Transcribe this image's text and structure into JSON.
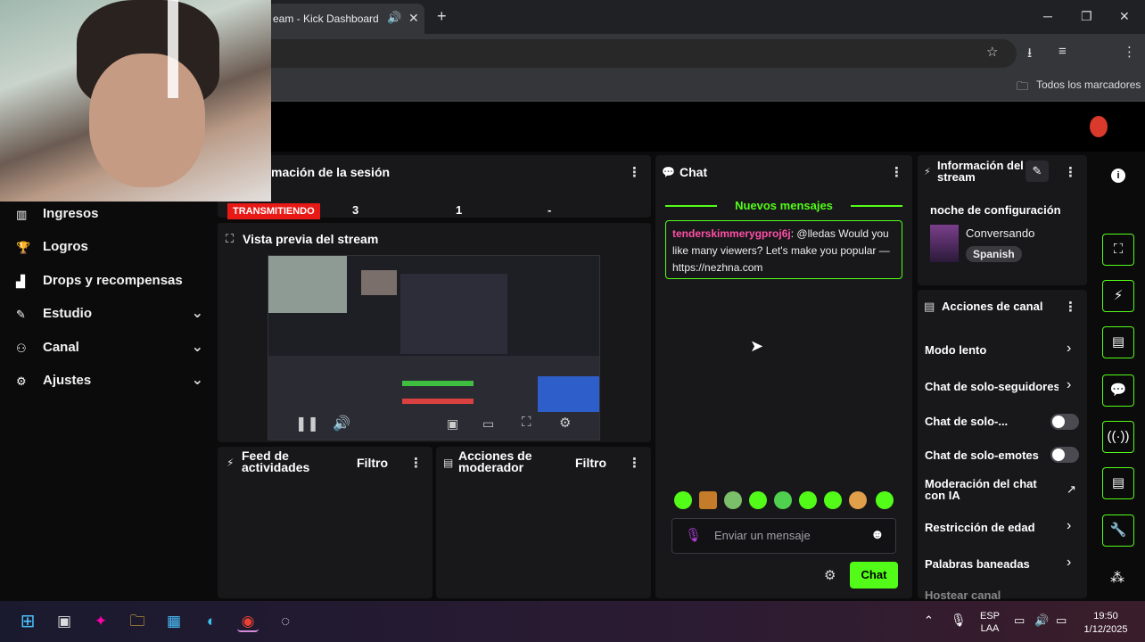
{
  "browser": {
    "tab_title": "eam - Kick Dashboard",
    "tab_speaker_icon": "🔊",
    "tab_close": "✕",
    "new_tab": "+",
    "win_minimize": "─",
    "win_maximize": "❐",
    "win_close": "✕",
    "bookmarks_label": "Todos los marcadores"
  },
  "sidebar": {
    "items": [
      {
        "label": "Ingresos",
        "icon": "▥"
      },
      {
        "label": "Logros",
        "icon": "🏆"
      },
      {
        "label": "Drops y recompensas",
        "icon": "▟"
      },
      {
        "label": "Estudio",
        "icon": "✎",
        "chevron": "⌄"
      },
      {
        "label": "Canal",
        "icon": "⚇",
        "chevron": "⌄"
      },
      {
        "label": "Ajustes",
        "icon": "⚙",
        "chevron": "⌄"
      }
    ]
  },
  "session": {
    "title": "mación de la sesión",
    "status": "TRANSMITIENDO",
    "stats": [
      "3",
      "1",
      "-"
    ]
  },
  "preview": {
    "title": "Vista previa del stream"
  },
  "activity": {
    "title": "Feed de actividades",
    "filter": "Filtro"
  },
  "modactions": {
    "title": "Acciones de moderador",
    "filter": "Filtro"
  },
  "chat": {
    "title": "Chat",
    "new_messages": "Nuevos mensajes",
    "message_user": "tenderskimmerygproj6j",
    "message_text": ": @lledas Would you like many viewers? Let's make you popular — https://nezhna.com",
    "input_placeholder": "Enviar un mensaje",
    "send_label": "Chat"
  },
  "stream_info": {
    "title": "Información del stream",
    "stream_title": "noche de configuración",
    "category": "Conversando",
    "language": "Spanish"
  },
  "channel_actions": {
    "title": "Acciones de canal",
    "items": [
      {
        "label": "Modo lento",
        "type": "chevron"
      },
      {
        "label": "Chat de solo-seguidores",
        "type": "chevron"
      },
      {
        "label": "Chat de solo-...",
        "type": "toggle",
        "on": false
      },
      {
        "label": "Chat de solo-emotes",
        "type": "toggle",
        "on": false
      },
      {
        "label": "Moderación del chat con IA",
        "type": "external"
      },
      {
        "label": "Restricción de edad",
        "type": "chevron"
      },
      {
        "label": "Palabras baneadas",
        "type": "chevron"
      },
      {
        "label": "Hostear canal",
        "type": "chevron"
      }
    ]
  },
  "taskbar": {
    "lang_top": "ESP",
    "lang_bottom": "LAA",
    "time": "19:50",
    "date": "1/12/2025"
  },
  "colors": {
    "accent": "#53fc18",
    "live": "#e91916",
    "username": "#ff4fa6"
  }
}
